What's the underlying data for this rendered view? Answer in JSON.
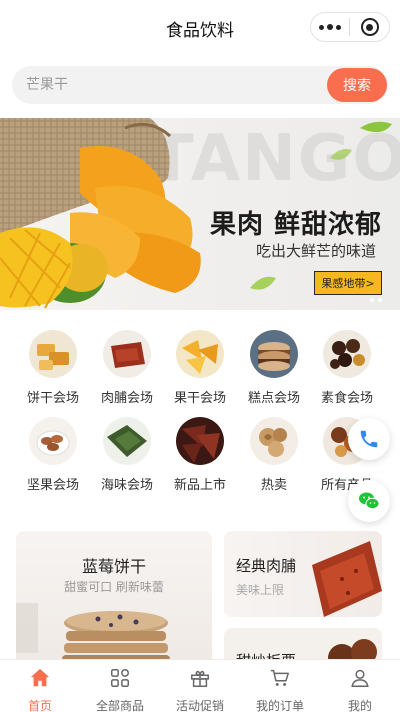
{
  "header": {
    "title": "食品饮料"
  },
  "search": {
    "placeholder": "芒果干",
    "button_label": "搜索"
  },
  "banner": {
    "bg_word": "TANGO",
    "headline": "果肉 鲜甜浓郁",
    "subline": "吃出大鲜芒的味道",
    "cta_label": "果感地带>"
  },
  "categories": [
    {
      "label": "饼干会场",
      "icon": "biscuit"
    },
    {
      "label": "肉脯会场",
      "icon": "jerky"
    },
    {
      "label": "果干会场",
      "icon": "dried-fruit"
    },
    {
      "label": "糕点会场",
      "icon": "pastry"
    },
    {
      "label": "素食会场",
      "icon": "vegetarian"
    },
    {
      "label": "坚果会场",
      "icon": "nuts"
    },
    {
      "label": "海味会场",
      "icon": "seafood"
    },
    {
      "label": "新品上市",
      "icon": "new"
    },
    {
      "label": "热卖",
      "icon": "hot"
    },
    {
      "label": "所有产品",
      "icon": "all"
    }
  ],
  "promos": {
    "left": {
      "title": "蓝莓饼干",
      "subtitle": "甜蜜可口 刷新味蕾"
    },
    "right_top": {
      "title": "经典肉脯",
      "subtitle": "美味上限"
    },
    "right_bottom": {
      "title": "甜炒板栗"
    }
  },
  "tabbar": [
    {
      "label": "首页",
      "icon": "home",
      "active": true
    },
    {
      "label": "全部商品",
      "icon": "grid",
      "active": false
    },
    {
      "label": "活动促销",
      "icon": "gift",
      "active": false
    },
    {
      "label": "我的订单",
      "icon": "cart",
      "active": false
    },
    {
      "label": "我的",
      "icon": "user",
      "active": false
    }
  ],
  "colors": {
    "accent": "#f86e4e",
    "banner_cta": "#f5b91f"
  }
}
